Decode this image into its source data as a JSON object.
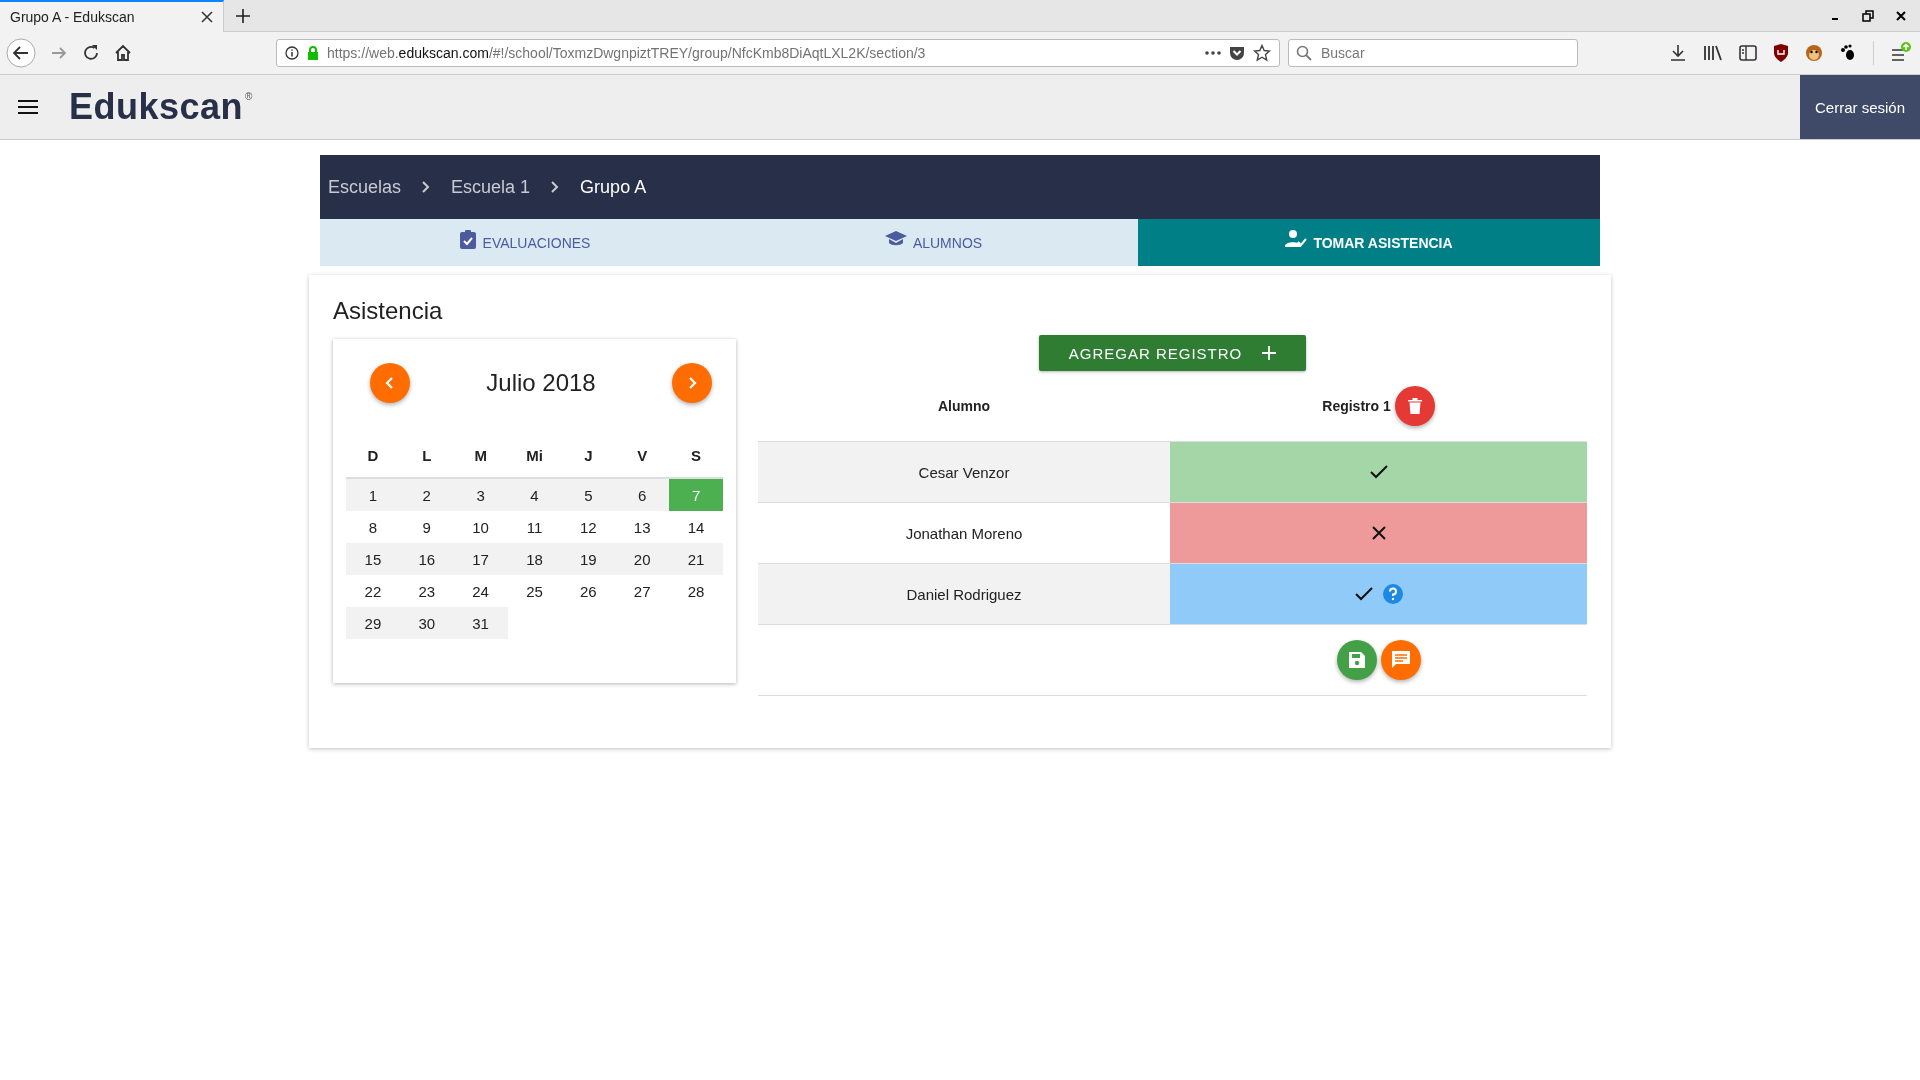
{
  "browser": {
    "tab_title": "Grupo A - Edukscan",
    "url": {
      "prefix": "https://web.",
      "domain": "edukscan.com",
      "path": "/#!/school/ToxmzDwgnpiztTREY/group/NfcKmb8DiAqtLXL2K/section/3"
    },
    "search": {
      "placeholder": "Buscar"
    }
  },
  "app": {
    "logo": "Edukscan",
    "logo_mark": "®",
    "logout": "Cerrar sesión"
  },
  "breadcrumb": [
    {
      "label": "Escuelas",
      "current": false
    },
    {
      "label": "Escuela 1",
      "current": false
    },
    {
      "label": "Grupo A",
      "current": true
    }
  ],
  "tabs": [
    {
      "label": "EVALUACIONES",
      "kind": "evaluations",
      "selected": false
    },
    {
      "label": "ALUMNOS",
      "kind": "students",
      "selected": false
    },
    {
      "label": "TOMAR ASISTENCIA",
      "kind": "attendance",
      "selected": true
    }
  ],
  "title": "Asistencia",
  "calendar": {
    "month": "Julio 2018",
    "weekdays": [
      "D",
      "L",
      "M",
      "Mi",
      "J",
      "V",
      "S"
    ],
    "days": [
      {
        "label": "1",
        "selected": false
      },
      {
        "label": "2",
        "selected": false
      },
      {
        "label": "3",
        "selected": false
      },
      {
        "label": "4",
        "selected": false
      },
      {
        "label": "5",
        "selected": false
      },
      {
        "label": "6",
        "selected": false
      },
      {
        "label": "7",
        "selected": true
      },
      {
        "label": "8",
        "selected": false
      },
      {
        "label": "9",
        "selected": false
      },
      {
        "label": "10",
        "selected": false
      },
      {
        "label": "11",
        "selected": false
      },
      {
        "label": "12",
        "selected": false
      },
      {
        "label": "13",
        "selected": false
      },
      {
        "label": "14",
        "selected": false
      },
      {
        "label": "15",
        "selected": false
      },
      {
        "label": "16",
        "selected": false
      },
      {
        "label": "17",
        "selected": false
      },
      {
        "label": "18",
        "selected": false
      },
      {
        "label": "19",
        "selected": false
      },
      {
        "label": "20",
        "selected": false
      },
      {
        "label": "21",
        "selected": false
      },
      {
        "label": "22",
        "selected": false
      },
      {
        "label": "23",
        "selected": false
      },
      {
        "label": "24",
        "selected": false
      },
      {
        "label": "25",
        "selected": false
      },
      {
        "label": "26",
        "selected": false
      },
      {
        "label": "27",
        "selected": false
      },
      {
        "label": "28",
        "selected": false
      },
      {
        "label": "29",
        "selected": false
      },
      {
        "label": "30",
        "selected": false
      },
      {
        "label": "31",
        "selected": false
      }
    ]
  },
  "add_button": "AGREGAR REGISTRO",
  "table": {
    "columns": [
      "Alumno",
      "Registro 1"
    ],
    "rows": [
      {
        "student": "Cesar Venzor",
        "kind": "present"
      },
      {
        "student": "Jonathan Moreno",
        "kind": "absent"
      },
      {
        "student": "Daniel Rodriguez",
        "kind": "doubtful"
      }
    ]
  }
}
